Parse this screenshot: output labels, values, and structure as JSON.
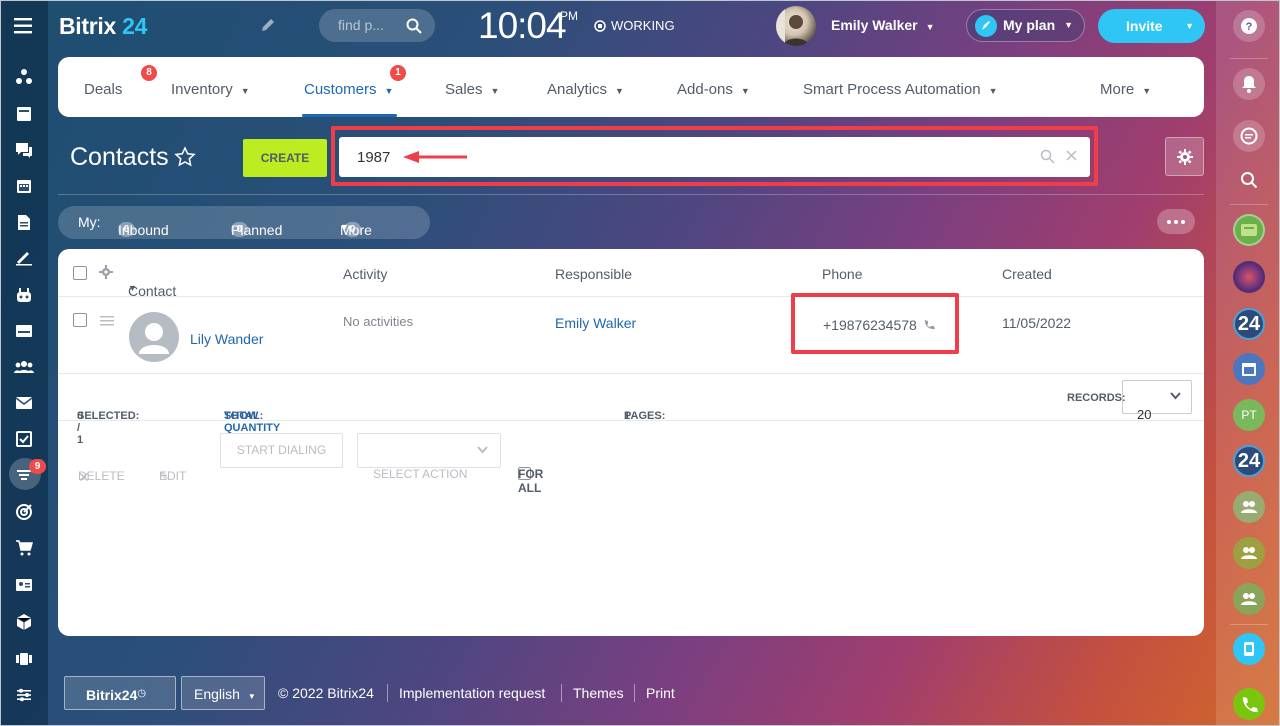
{
  "app": {
    "logo_main": "Bitrix",
    "logo_num": "24"
  },
  "topbar": {
    "search_placeholder": "find p...",
    "time": "10:04",
    "ampm": "PM",
    "status": "WORKING",
    "user_name": "Emily Walker",
    "plan_label": "My plan",
    "invite_label": "Invite"
  },
  "sidebar": {
    "icons": [
      "sitemap-icon",
      "feed-icon",
      "chat-icon",
      "calendar-icon",
      "document-icon",
      "sign-icon",
      "robot-icon",
      "drive-icon",
      "group-icon",
      "mail-icon",
      "tasks-icon",
      "crm-funnel-icon",
      "target-icon",
      "cart-icon",
      "contact-card-icon",
      "cube-icon",
      "devices-icon",
      "settings-sliders-icon"
    ],
    "crm_badge": "9"
  },
  "nav": {
    "items": [
      {
        "label": "Deals",
        "badge": "8"
      },
      {
        "label": "Inventory"
      },
      {
        "label": "Customers",
        "badge": "1",
        "active": true
      },
      {
        "label": "Sales"
      },
      {
        "label": "Analytics"
      },
      {
        "label": "Add-ons"
      },
      {
        "label": "Smart Process Automation"
      },
      {
        "label": "More"
      }
    ]
  },
  "page": {
    "title": "Contacts",
    "create_label": "CREATE",
    "search_value": "1987"
  },
  "counters": {
    "my_label": "My:",
    "inbound_count": "0",
    "inbound_label": "Inbound",
    "planned_count": "0",
    "planned_label": "Planned",
    "more_label": "More",
    "more_count": "0"
  },
  "grid": {
    "columns": [
      "Contact",
      "Activity",
      "Responsible",
      "Phone",
      "Created"
    ],
    "rows": [
      {
        "contact": "Lily Wander",
        "activity": "No activities",
        "responsible": "Emily Walker",
        "phone": "+19876234578",
        "created": "11/05/2022"
      }
    ],
    "footer": {
      "selected_label": "SELECTED:",
      "selected_value": "0 / 1",
      "total_label": "TOTAL:",
      "total_link": "SHOW QUANTITY",
      "pages_label": "PAGES:",
      "pages_value": "1",
      "records_label": "RECORDS:",
      "records_value": "20"
    },
    "actions": {
      "delete": "DELETE",
      "edit": "EDIT",
      "start_dialing": "START DIALING",
      "select_action": "SELECT ACTION",
      "for_all": "FOR ALL"
    }
  },
  "right_sidebar": {
    "items": [
      "help-icon",
      "bell-icon",
      "chat-bubble-icon",
      "search-icon",
      "group-chat-green",
      "avatar-crowd",
      "24",
      "calendar-chat",
      "PT",
      "24",
      "group-chat-1",
      "group-chat-2",
      "group-chat-3",
      "phone-app-icon",
      "call-icon"
    ]
  },
  "footer": {
    "brand": "Bitrix24",
    "language": "English",
    "copyright": "© 2022 Bitrix24",
    "implementation": "Implementation request",
    "themes": "Themes",
    "print": "Print"
  },
  "colors": {
    "accent": "#2fc6f6",
    "create": "#bbed21",
    "link": "#2067b0",
    "badge": "#f04b4b",
    "highlight": "#ef3e4a"
  }
}
